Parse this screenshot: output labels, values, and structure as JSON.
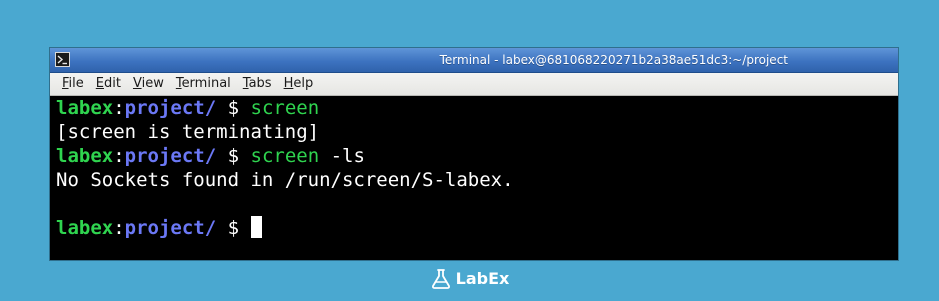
{
  "window": {
    "title": "Terminal - labex@681068220271b2a38ae51dc3:~/project"
  },
  "menubar": {
    "items": [
      {
        "mnemonic": "F",
        "rest": "ile"
      },
      {
        "mnemonic": "E",
        "rest": "dit"
      },
      {
        "mnemonic": "V",
        "rest": "iew"
      },
      {
        "mnemonic": "T",
        "rest": "erminal"
      },
      {
        "mnemonic": "T",
        "rest": "abs"
      },
      {
        "mnemonic": "H",
        "rest": "elp"
      }
    ]
  },
  "terminal": {
    "prompt_user": "labex",
    "prompt_colon": ":",
    "prompt_path": "project/",
    "prompt_symbol": " $ ",
    "lines": [
      {
        "type": "prompt",
        "cmd": "screen",
        "args": ""
      },
      {
        "type": "output",
        "text": "[screen is terminating]"
      },
      {
        "type": "prompt",
        "cmd": "screen",
        "args": " -ls"
      },
      {
        "type": "output",
        "text": "No Sockets found in /run/screen/S-labex."
      },
      {
        "type": "blank"
      },
      {
        "type": "prompt_cursor"
      }
    ]
  },
  "brand": {
    "name": "LabEx",
    "icon": "flask-icon"
  },
  "colors": {
    "background": "#4aa8d0",
    "user": "#2fd44f",
    "path": "#6b78f5",
    "command": "#2fd44f",
    "terminal_bg": "#000000"
  }
}
